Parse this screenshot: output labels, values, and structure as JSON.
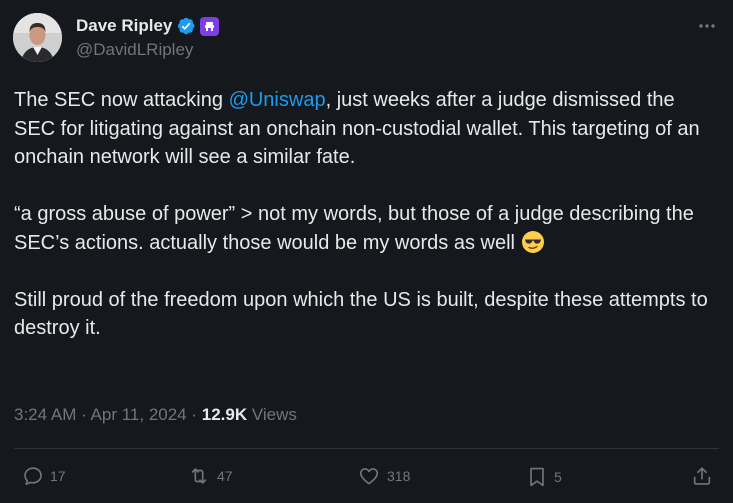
{
  "author": {
    "display_name": "Dave Ripley",
    "handle": "@DavidLRipley",
    "verified_color": "#1d9bf0",
    "affiliation_color": "#7b3fe4"
  },
  "more_icon": "more-horizontal-icon",
  "tweet": {
    "p1_before": "The SEC now attacking ",
    "p1_mention": "@Uniswap",
    "p1_after": ", just weeks after a judge dismissed the SEC for litigating against an onchain non-custodial wallet. This targeting of an onchain network will see a similar fate.",
    "p2": "“a gross abuse of power” > not my words, but those of a judge describing the SEC’s actions.  actually those would be my words as well",
    "p2_emoji": "sunglasses-face-emoji",
    "p3": "Still proud of the freedom upon which the US is built, despite these attempts to destroy it."
  },
  "meta": {
    "time": "3:24 AM",
    "sep1": " · ",
    "date": "Apr 11, 2024",
    "sep2": " · ",
    "views_count": "12.9K",
    "views_label": " Views"
  },
  "actions": {
    "replies": "17",
    "reposts": "47",
    "likes": "318",
    "bookmarks": "5"
  },
  "colors": {
    "background": "#15181c",
    "text": "#e7e9ea",
    "muted": "#71767b",
    "link": "#1d9bf0"
  }
}
